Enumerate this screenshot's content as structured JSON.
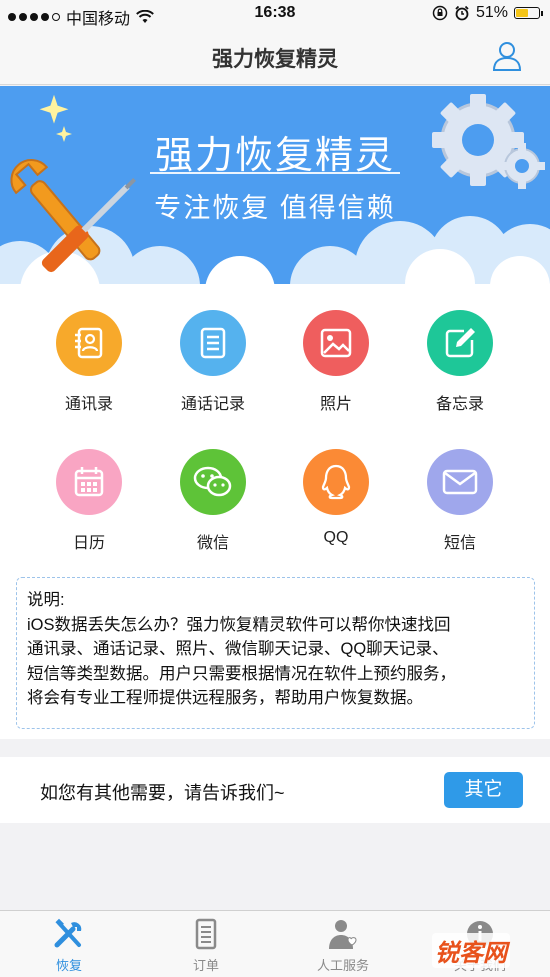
{
  "status_bar": {
    "carrier": "中国移动",
    "time": "16:38",
    "battery": "51%"
  },
  "nav": {
    "title": "强力恢复精灵",
    "user_icon": "user-icon"
  },
  "banner": {
    "title": "强力恢复精灵",
    "subtitle": "专注恢复  值得信赖"
  },
  "grid": [
    {
      "label": "通讯录",
      "icon": "contacts-icon",
      "color": "#f7a92b"
    },
    {
      "label": "通话记录",
      "icon": "call-log-icon",
      "color": "#55b2ee"
    },
    {
      "label": "照片",
      "icon": "photo-icon",
      "color": "#ef5e5e"
    },
    {
      "label": "备忘录",
      "icon": "notes-icon",
      "color": "#1ec798"
    },
    {
      "label": "日历",
      "icon": "calendar-icon",
      "color": "#f9a5c3"
    },
    {
      "label": "微信",
      "icon": "wechat-icon",
      "color": "#5ec338"
    },
    {
      "label": "QQ",
      "icon": "qq-icon",
      "color": "#fb8a35"
    },
    {
      "label": "短信",
      "icon": "sms-icon",
      "color": "#9fa7ec"
    }
  ],
  "description": {
    "heading": "说明:",
    "lines": [
      "iOS数据丢失怎么办？强力恢复精灵软件可以帮你快速找回",
      "通讯录、通话记录、照片、微信聊天记录、QQ聊天记录、",
      "短信等类型数据。用户只需要根据情况在软件上预约服务，",
      "将会有专业工程师提供远程服务，帮助用户恢复数据。"
    ]
  },
  "contact": {
    "text": "如您有其他需要，请告诉我们~",
    "button": "其它"
  },
  "tabs": [
    {
      "label": "恢复",
      "icon": "tools-icon",
      "active": true
    },
    {
      "label": "订单",
      "icon": "order-icon",
      "active": false
    },
    {
      "label": "人工服务",
      "icon": "service-icon",
      "active": false
    },
    {
      "label": "关于我们",
      "icon": "info-icon",
      "active": false
    }
  ],
  "watermark": "锐客网",
  "colors": {
    "accent": "#2f9ae8",
    "banner": "#4d9df0"
  }
}
